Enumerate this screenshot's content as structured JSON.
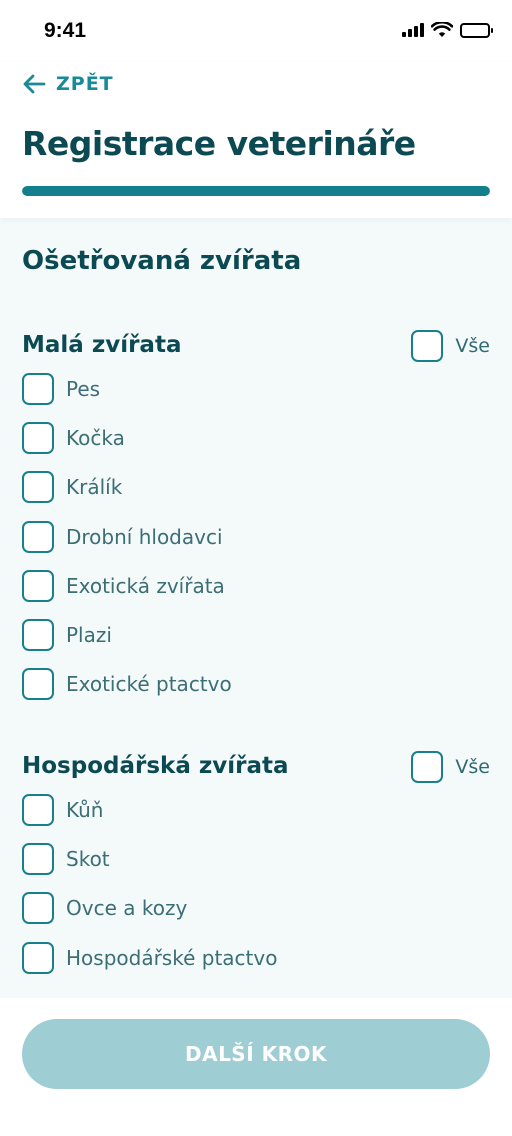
{
  "status_bar": {
    "time": "9:41",
    "icons": [
      "signal-icon",
      "wifi-icon",
      "battery-icon"
    ]
  },
  "header": {
    "back_label": "ZPĚT",
    "title": "Registrace veterináře",
    "progress": 1.0
  },
  "form": {
    "section_title": "Ošetřovaná zvířata",
    "groups": [
      {
        "title": "Malá zvířata",
        "all_label": "Vše",
        "options": [
          "Pes",
          "Kočka",
          "Králík",
          "Drobní hlodavci",
          "Exotická zvířata",
          "Plazi",
          "Exotické ptactvo"
        ]
      },
      {
        "title": "Hospodářská zvířata",
        "all_label": "Vše",
        "options": [
          "Kůň",
          "Skot",
          "Ovce a kozy",
          "Hospodářské ptactvo"
        ]
      }
    ]
  },
  "footer": {
    "next_label": "DALŠÍ KROK"
  },
  "colors": {
    "accent": "#137f8d",
    "title": "#0c4a53",
    "button_disabled": "#9ecdd4",
    "content_bg": "#f4f9fa"
  }
}
